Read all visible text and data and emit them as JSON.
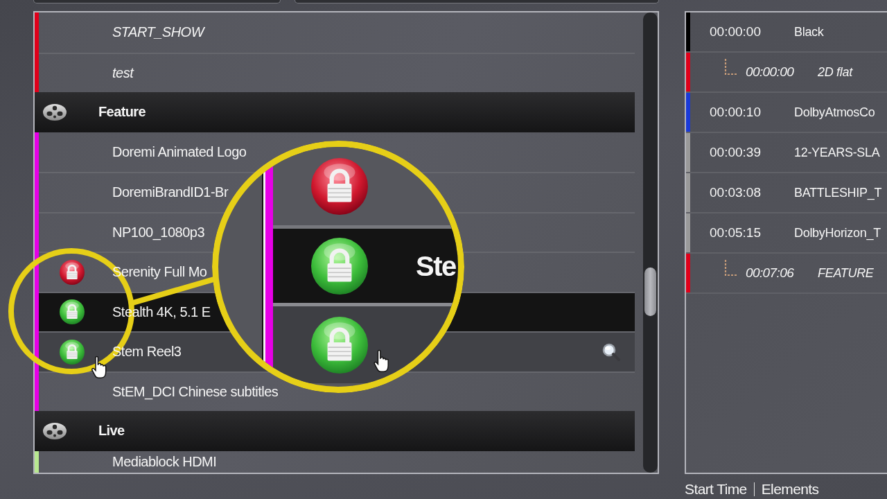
{
  "playlist": {
    "items": [
      {
        "kind": "macro",
        "title": "START_SHOW",
        "color": "#e0001a",
        "selected": false,
        "hovered": false
      },
      {
        "kind": "macro",
        "title": "test",
        "color": "#e0001a",
        "selected": false,
        "hovered": false
      }
    ],
    "groups": [
      {
        "title": "Feature",
        "items": [
          {
            "kind": "clip",
            "title": "Doremi Animated Logo",
            "color": "#e600e6",
            "selected": false,
            "hovered": false
          },
          {
            "kind": "clip",
            "title": "DoremiBrandID1-Br",
            "color": "#e600e6",
            "selected": false,
            "hovered": false
          },
          {
            "kind": "clip",
            "title": "NP100_1080p3",
            "color": "#e600e6",
            "selected": false,
            "hovered": false
          },
          {
            "kind": "clip",
            "title": "Serenity Full Mo",
            "color": "#e600e6",
            "key_valid": false,
            "selected": false,
            "hovered": false
          },
          {
            "kind": "clip",
            "title": "Stealth 4K, 5.1 E",
            "color": "#e600e6",
            "key_valid": true,
            "selected": true,
            "hovered": false
          },
          {
            "kind": "clip",
            "title": "Stem Reel3",
            "color": "#e600e6",
            "key_valid": true,
            "selected": false,
            "hovered": true
          },
          {
            "kind": "clip",
            "title": "StEM_DCI Chinese subtitles",
            "color": "#e600e6",
            "selected": false,
            "hovered": false
          }
        ]
      },
      {
        "title": "Live",
        "items": [
          {
            "kind": "clip",
            "title": "Mediablock HDMI",
            "color": "#b8e890",
            "selected": false,
            "hovered": false
          }
        ]
      }
    ]
  },
  "magnifier": {
    "rows": [
      {
        "key_valid": false,
        "selected": false
      },
      {
        "key_valid": true,
        "selected": true,
        "text": "Ste"
      },
      {
        "key_valid": true,
        "selected": false
      }
    ]
  },
  "timeline": {
    "items": [
      {
        "time": "00:00:00",
        "name": "Black",
        "color": "#000000",
        "children": [
          {
            "time": "00:00:00",
            "name": "2D flat",
            "color": "#e0001a"
          }
        ]
      },
      {
        "time": "00:00:10",
        "name": "DolbyAtmosCo",
        "color": "#1a3ad8"
      },
      {
        "time": "00:00:39",
        "name": "12-YEARS-SLA",
        "color": "#9a9a9a"
      },
      {
        "time": "00:03:08",
        "name": "BATTLESHIP_T",
        "color": "#9a9a9a"
      },
      {
        "time": "00:05:15",
        "name": "DolbyHorizon_T",
        "color": "#9a9a9a",
        "children": [
          {
            "time": "00:07:06",
            "name": "FEATURE",
            "color": "#e0001a"
          }
        ]
      }
    ]
  },
  "footer": {
    "labels": [
      "Start Time",
      "Elements"
    ]
  }
}
